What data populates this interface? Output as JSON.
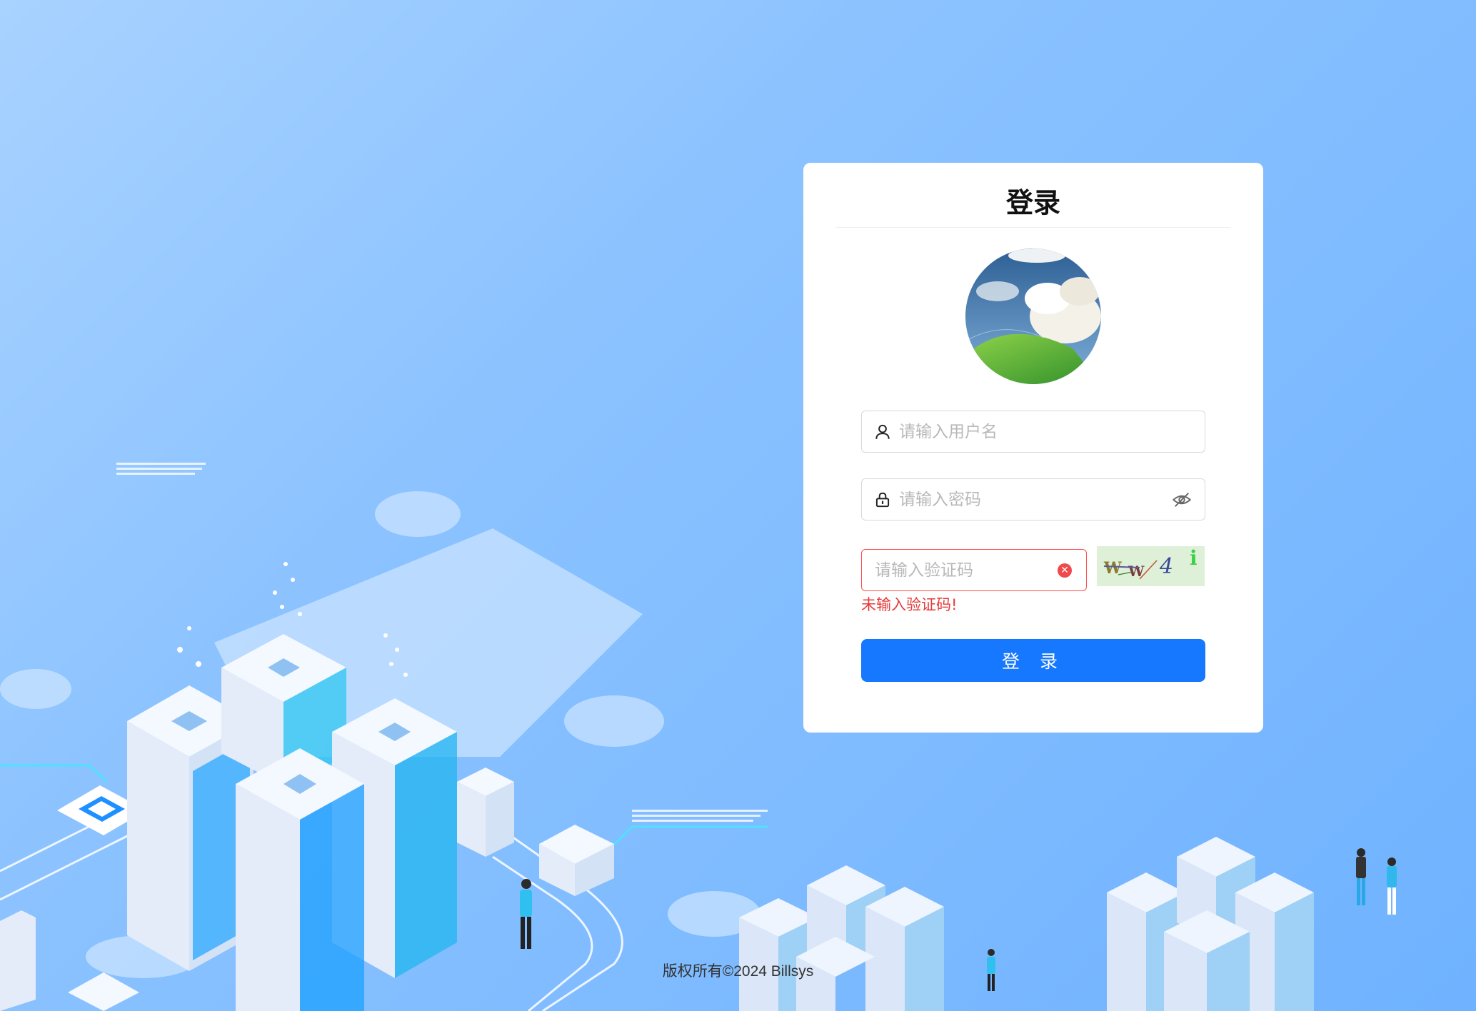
{
  "page": {
    "bg_color": "#8cc3ff",
    "accent": "#1677ff"
  },
  "card": {
    "title": "登录",
    "username": {
      "placeholder": "请输入用户名",
      "icon": "user-icon"
    },
    "password": {
      "placeholder": "请输入密码",
      "icon": "lock-icon",
      "toggle_icon": "eye-off-icon"
    },
    "captcha": {
      "placeholder": "请输入验证码",
      "clear_icon": "clear-icon",
      "image_text": "W W 4 i",
      "error": "未输入验证码!"
    },
    "login_button": "登 录"
  },
  "footer": {
    "copyright": "版权所有©2024 Billsys"
  }
}
